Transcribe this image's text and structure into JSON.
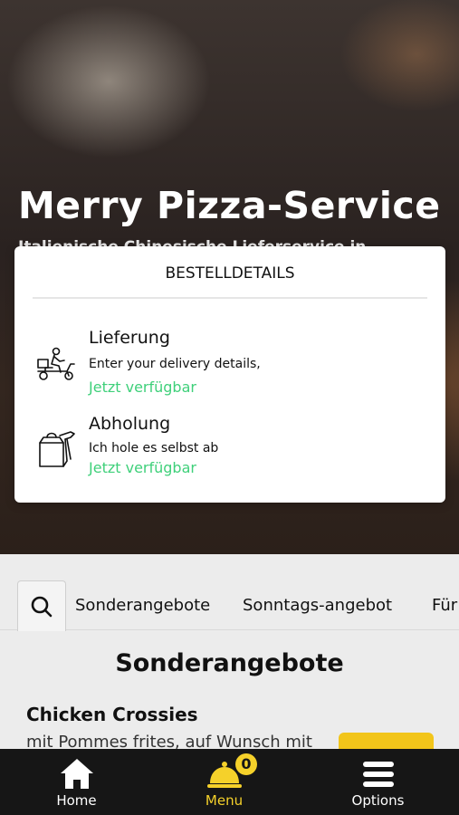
{
  "hero": {
    "title": "Merry Pizza-Service",
    "subtitle": "Italienische Chinesische Lieferservice in"
  },
  "order_modal": {
    "header": "BESTELLDETAILS",
    "delivery": {
      "title": "Lieferung",
      "description": "Enter your delivery details,",
      "status": "Jetzt verfügbar",
      "icon": "scooter-delivery-icon"
    },
    "pickup": {
      "title": "Abholung",
      "description": "Ich hole es selbst ab",
      "status": "Jetzt verfügbar",
      "icon": "takeaway-bag-icon"
    },
    "status_color": "#3fd07a"
  },
  "categories": {
    "tabs": [
      "Sonderangebote",
      "Sonntags-angebot",
      "Für"
    ]
  },
  "content": {
    "section_title": "Sonderangebote",
    "items": [
      {
        "name": "Chicken Crossies",
        "description": "mit Pommes frites, auf Wunsch mit"
      }
    ]
  },
  "bottom_nav": {
    "home_label": "Home",
    "menu_label": "Menu",
    "options_label": "Options",
    "cart_count": "0",
    "accent_color": "#f5d12a"
  }
}
